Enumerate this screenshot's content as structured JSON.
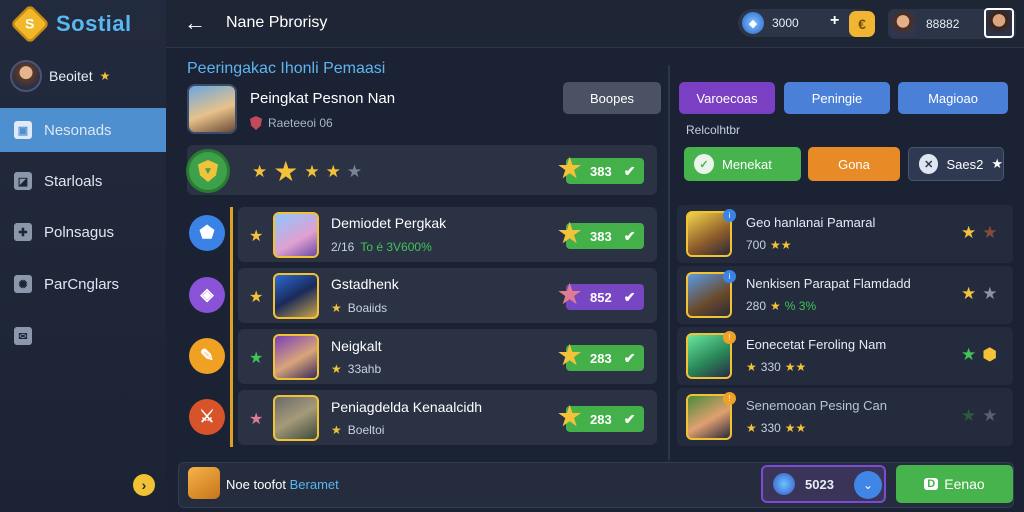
{
  "app": {
    "logo_text": "Sostial",
    "logo_glyph": "S"
  },
  "sidebar": {
    "profile_name": "Beoitet",
    "items": [
      {
        "label": "Nesonads",
        "icon": "user-icon",
        "glyph": "▣",
        "active": true
      },
      {
        "label": "Starloals",
        "icon": "chart-icon",
        "glyph": "◪"
      },
      {
        "label": "Polnsagus",
        "icon": "puzzle-icon",
        "glyph": "✚"
      },
      {
        "label": "ParCnglars",
        "icon": "gear-icon",
        "glyph": "✺"
      },
      {
        "label": "",
        "icon": "mail-icon",
        "glyph": "✉"
      }
    ],
    "collapse_glyph": "›"
  },
  "topbar": {
    "back_glyph": "←",
    "title": "Nane Pbrorisy",
    "currency_value": "3000",
    "plus_glyph": "+",
    "gold_glyph": "€",
    "rank_value": "88882"
  },
  "main": {
    "section_title": "Peeringakac Ihonli Pemaasi",
    "hero_title": "Peingkat Pesnon Nan",
    "hero_sub": "Raeteeoi 06",
    "options_label": "Boopes",
    "rating": {
      "stars": 5,
      "filled": 4,
      "score": "383"
    },
    "rows": [
      {
        "title": "Demiodet Pergkak",
        "sub_a": "2/16",
        "sub_b": "To é 3V600%",
        "score": "383",
        "icon": "shield-icon",
        "icon_color": "#3b82e6",
        "marker": "★",
        "marker_color": "#f4c23a",
        "thumb": "linear-gradient(150deg,#8ec6ff,#e0a0d0 60%,#6a4aa8)",
        "pill": "green"
      },
      {
        "title": "Gstadhenk",
        "sub_a": "★",
        "sub_b": "Boaiids",
        "score": "852",
        "icon": "cube-icon",
        "icon_color": "#8a52d6",
        "marker": "★",
        "marker_color": "#f4c23a",
        "thumb": "linear-gradient(150deg,#2c6ad6,#1a2a5a 50%,#c9a34a)",
        "pill": "purple"
      },
      {
        "title": "Neigkalt",
        "sub_a": "★",
        "sub_b": "33ahb",
        "score": "283",
        "icon": "task-icon",
        "icon_color": "#f0a023",
        "marker": "★",
        "marker_color": "#42c45a",
        "thumb": "linear-gradient(150deg,#7a3fb8,#d8a47a 55%,#3a2a5a)",
        "pill": "green"
      },
      {
        "title": "Peniagdelda Kenaalcidh",
        "sub_a": "★",
        "sub_b": "Boeltoi",
        "score": "283",
        "icon": "sword-icon",
        "icon_color": "#d8532a",
        "marker": "★",
        "marker_color": "#e07c8f",
        "thumb": "linear-gradient(150deg,#6a6a6a,#a59a7a 50%,#3a4a3a)",
        "pill": "green"
      }
    ]
  },
  "tabs": [
    {
      "label": "Varoecoas",
      "color": "#7a3fc2"
    },
    {
      "label": "Peningie",
      "color": "#4a80d8"
    },
    {
      "label": "Magioao",
      "color": "#4a80d8"
    }
  ],
  "right": {
    "filter_label": "Relcolhtbr",
    "chips": [
      {
        "label": "Menekat",
        "color": "#46b34c",
        "icon": "check-icon",
        "glyph": "✓"
      },
      {
        "label": "Gona",
        "color": "#e88a25"
      },
      {
        "label": "Saes2",
        "color": "#2f3a52",
        "icon": "shield-icon",
        "glyph": "✕",
        "star": "★"
      }
    ],
    "rows": [
      {
        "title": "Geo hanlanai Pamaral",
        "sub": "700",
        "thumb": "linear-gradient(150deg,#f2d24a,#8a5a2a 60%,#2a2a3a)",
        "marks": [
          "★",
          "★"
        ],
        "mark_colors": [
          "#f4c23a",
          "#8a4a3a"
        ]
      },
      {
        "title": "Nenkisen Parapat Flamdadd",
        "sub": "280",
        "sub_g": "% 3%",
        "thumb": "linear-gradient(150deg,#5a9ae6,#6a4a2a 60%,#2a2a3a)",
        "marks": [
          "★",
          "★"
        ],
        "mark_colors": [
          "#f4c23a",
          "#8b93a5"
        ]
      },
      {
        "title": "Eonecetat Feroling Nam",
        "sub": "330",
        "thumb": "linear-gradient(150deg,#6ae6a0,#2a8a5a 55%,#2a2a4a)",
        "marks": [
          "★",
          "⬢"
        ],
        "mark_colors": [
          "#42c45a",
          "#f4c23a"
        ]
      },
      {
        "title": "Senemooan Pesing Can",
        "sub": "330",
        "thumb": "linear-gradient(150deg,#4a8a3a,#e0a070 55%,#2a2a3a)",
        "marks": [
          "★",
          "★"
        ],
        "mark_colors": [
          "#2f5a3a",
          "#5a6070"
        ]
      }
    ]
  },
  "bottom": {
    "text_main": "Noe toofot",
    "text_accent": "Beramet",
    "cost": "5023",
    "arrow_glyph": "⌄",
    "confirm_label": "Eenao",
    "confirm_glyph": "D"
  },
  "colors": {
    "accent_blue": "#4e8fcf",
    "green": "#46b34c",
    "gold": "#f4c23a",
    "purple": "#7a3fc2"
  }
}
